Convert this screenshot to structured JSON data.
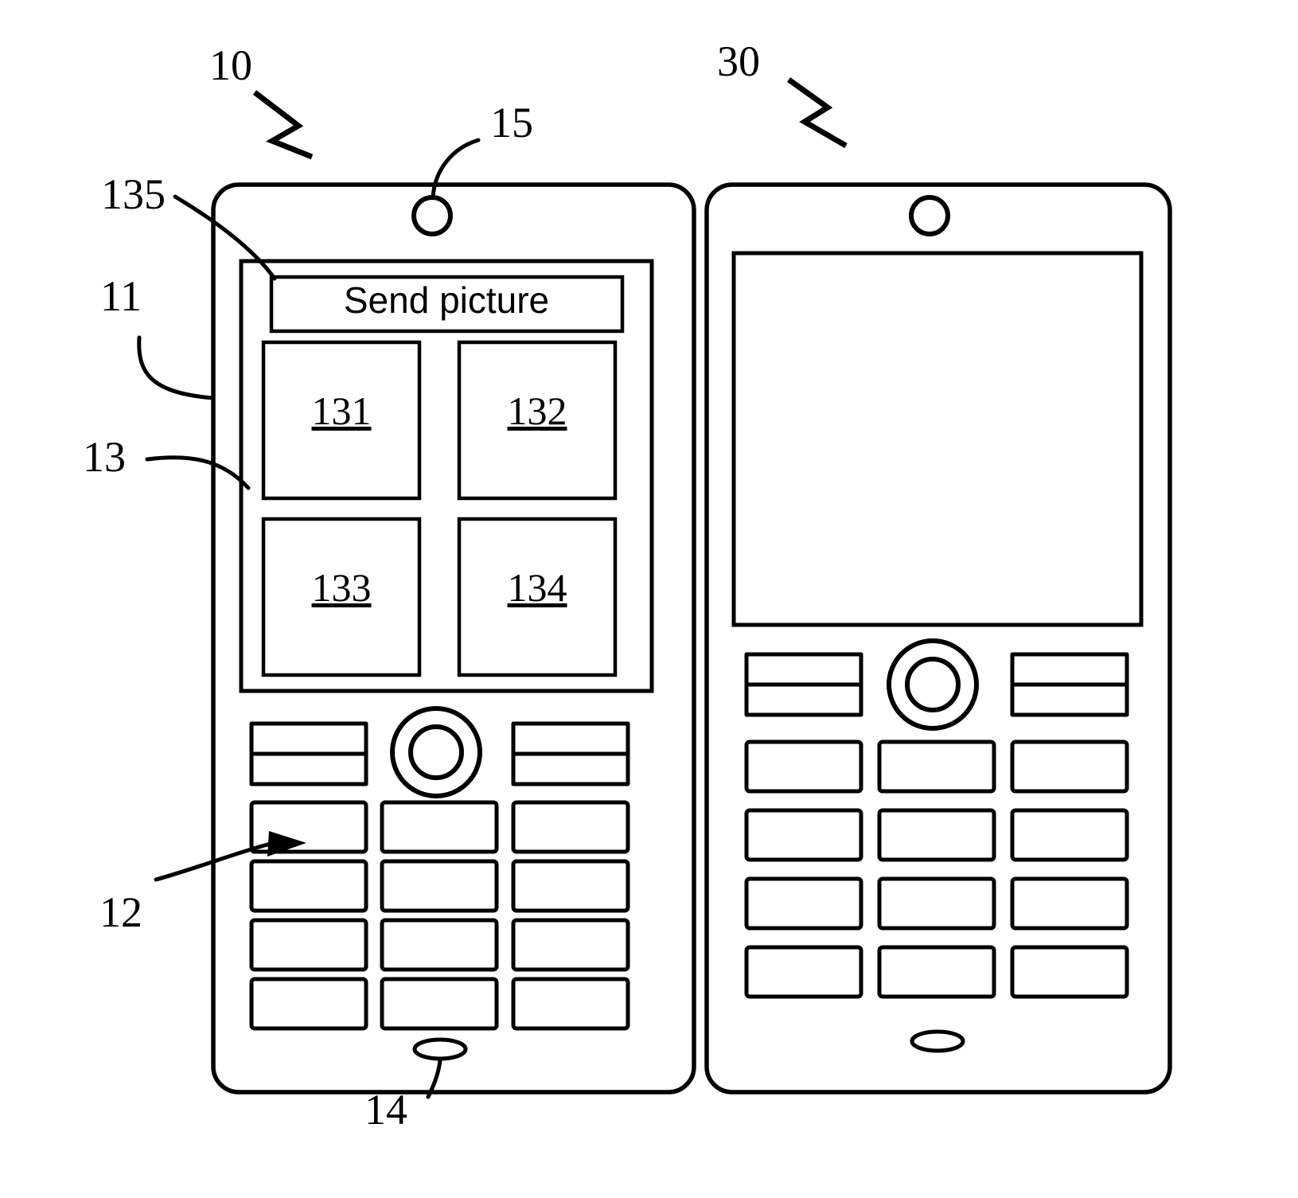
{
  "figure": {
    "type": "patent-line-drawing",
    "background_color": "#ffffff",
    "line_color": "#000000"
  },
  "reference_numerals": {
    "device_left": "10",
    "device_right": "30",
    "housing": "11",
    "keypad": "12",
    "display": "13",
    "microphone": "14",
    "earpiece": "15",
    "title_bar": "135"
  },
  "left_device": {
    "name": "mobile phone 10",
    "screen": {
      "title_bar_text": "Send picture",
      "thumbnails": [
        {
          "label": "131"
        },
        {
          "label": "132"
        },
        {
          "label": "133"
        },
        {
          "label": "134"
        }
      ]
    },
    "keypad": {
      "softkey_left": "",
      "softkey_right": "",
      "navigation_key": "",
      "rows": 4,
      "cols": 3
    },
    "earpiece": "",
    "microphone": ""
  },
  "right_device": {
    "name": "mobile phone 30",
    "screen": {
      "title_bar_text": "",
      "thumbnails": []
    },
    "keypad": {
      "softkey_left": "",
      "softkey_right": "",
      "navigation_key": "",
      "rows": 4,
      "cols": 3
    },
    "earpiece": "",
    "microphone": ""
  }
}
